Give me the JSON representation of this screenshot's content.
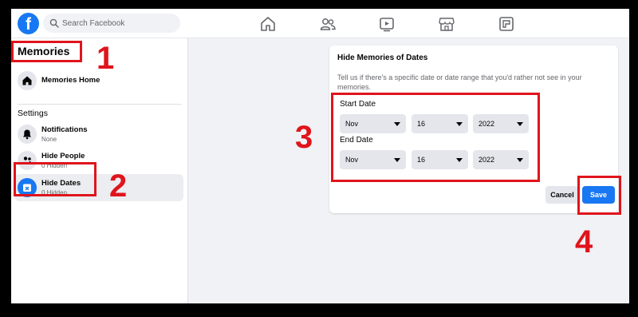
{
  "topbar": {
    "logo": "f",
    "search_placeholder": "Search Facebook",
    "nav_icons": [
      "home-icon",
      "friends-icon",
      "watch-icon",
      "marketplace-icon",
      "pages-icon"
    ]
  },
  "sidebar": {
    "title": "Memories",
    "home_label": "Memories Home",
    "settings_label": "Settings",
    "items": [
      {
        "label": "Notifications",
        "sub": "None"
      },
      {
        "label": "Hide People",
        "sub": "0 Hidden"
      },
      {
        "label": "Hide Dates",
        "sub": "0 Hidden"
      }
    ]
  },
  "card": {
    "title": "Hide Memories of Dates",
    "description": "Tell us if there's a specific date or date range that you'd rather not see in your memories.",
    "start_label": "Start Date",
    "end_label": "End Date",
    "start": {
      "month": "Nov",
      "day": "16",
      "year": "2022"
    },
    "end": {
      "month": "Nov",
      "day": "16",
      "year": "2022"
    },
    "cancel_label": "Cancel",
    "save_label": "Save"
  },
  "annotations": {
    "numbers": [
      "1",
      "2",
      "3",
      "4"
    ],
    "color": "#e0141c"
  },
  "colors": {
    "brand": "#1877f2",
    "background": "#f0f2f5"
  }
}
